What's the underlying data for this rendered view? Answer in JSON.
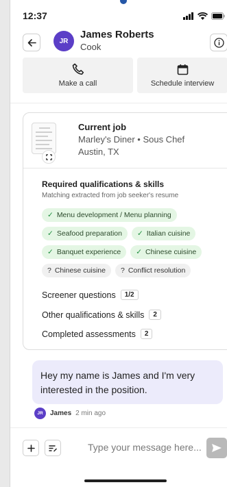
{
  "status": {
    "time": "12:37"
  },
  "header": {
    "initials": "JR",
    "name": "James Roberts",
    "role": "Cook"
  },
  "actions": [
    {
      "label": "Make a call",
      "icon": "phone-icon"
    },
    {
      "label": "Schedule interview",
      "icon": "calendar-icon"
    }
  ],
  "job": {
    "title": "Current job",
    "employer_role": "Marley's Diner • Sous Chef",
    "location": "Austin, TX"
  },
  "qualifications": {
    "title": "Required qualifications & skills",
    "subtitle": "Matching extracted from job seeker's resume",
    "matched": [
      "Menu development / Menu planning",
      "Seafood preparation",
      "Italian cuisine",
      "Banquet experience",
      "Chinese cuisine"
    ],
    "unknown": [
      "Chinese cuisine",
      "Conflict resolution"
    ]
  },
  "stats": [
    {
      "label": "Screener questions",
      "count": "1/2"
    },
    {
      "label": "Other qualifications & skills",
      "count": "2"
    },
    {
      "label": "Completed assessments",
      "count": "2"
    }
  ],
  "message": {
    "text": "Hey my name is James and I'm very interested in the position.",
    "sender_initials": "JR",
    "sender": "James",
    "time": "2 min ago"
  },
  "composer": {
    "placeholder": "Type your message here..."
  },
  "colors": {
    "accent": "#5b3ec7",
    "match_bg": "#e4f6e4",
    "bubble_bg": "#ecebfb",
    "indeed_blue": "#2557a7"
  }
}
